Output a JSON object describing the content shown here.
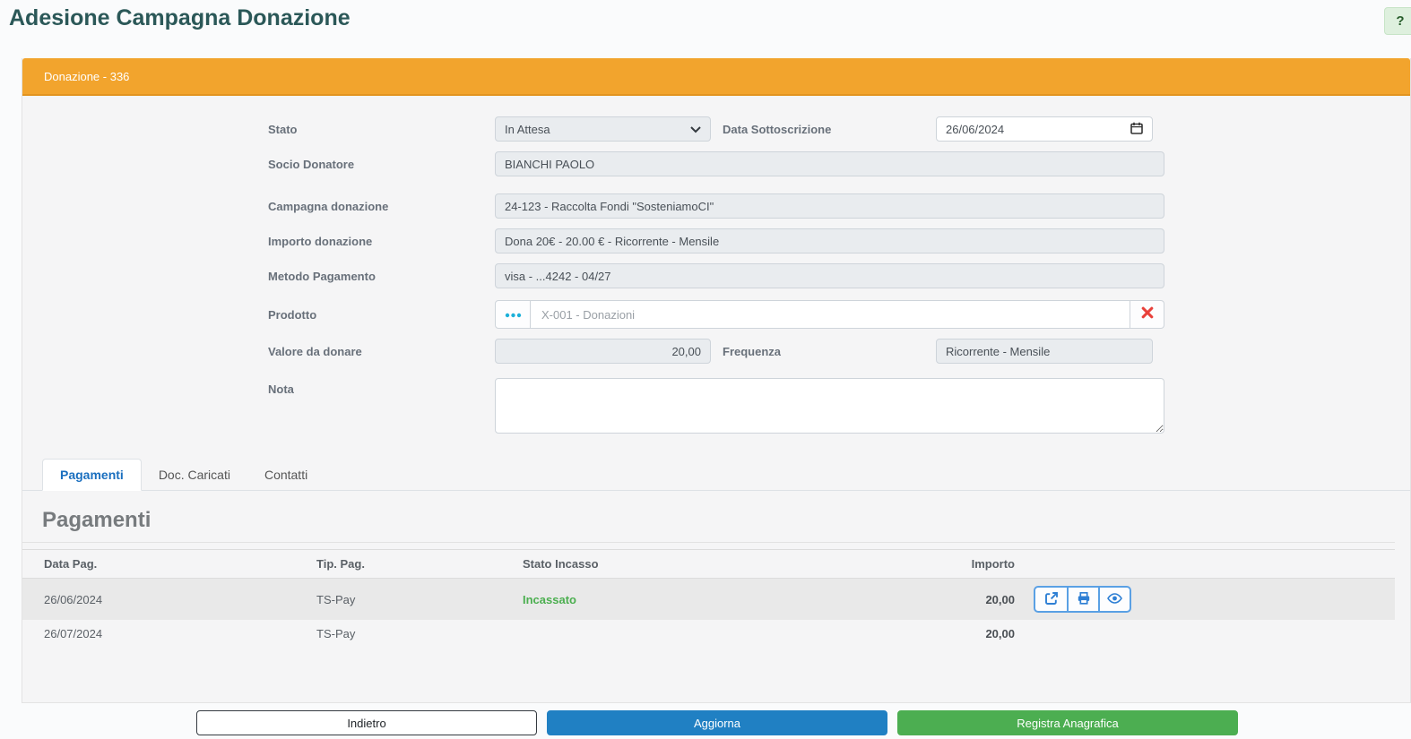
{
  "page": {
    "title": "Adesione Campagna Donazione",
    "help_label": "?"
  },
  "panel": {
    "header": "Donazione - 336"
  },
  "form": {
    "stato": {
      "label": "Stato",
      "value": "In Attesa"
    },
    "data_sottoscrizione": {
      "label": "Data Sottoscrizione",
      "value": "26/06/2024"
    },
    "socio_donatore": {
      "label": "Socio Donatore",
      "value": "BIANCHI PAOLO"
    },
    "campagna_donazione": {
      "label": "Campagna donazione",
      "value": "24-123 - Raccolta Fondi \"SosteniamoCI\""
    },
    "importo_donazione": {
      "label": "Importo donazione",
      "value": "Dona 20€ - 20.00 € - Ricorrente - Mensile"
    },
    "metodo_pagamento": {
      "label": "Metodo Pagamento",
      "value": "visa - ...4242 - 04/27"
    },
    "prodotto": {
      "label": "Prodotto",
      "value": "X-001 - Donazioni"
    },
    "valore_da_donare": {
      "label": "Valore da donare",
      "value": "20,00"
    },
    "frequenza": {
      "label": "Frequenza",
      "value": "Ricorrente - Mensile"
    },
    "nota": {
      "label": "Nota",
      "value": ""
    }
  },
  "tabs": [
    {
      "label": "Pagamenti",
      "active": true
    },
    {
      "label": "Doc. Caricati",
      "active": false
    },
    {
      "label": "Contatti",
      "active": false
    }
  ],
  "payments": {
    "section_title": "Pagamenti",
    "columns": {
      "data": "Data Pag.",
      "tipo": "Tip. Pag.",
      "stato": "Stato Incasso",
      "importo": "Importo"
    },
    "rows": [
      {
        "data_pag": "26/06/2024",
        "tip_pag": "TS-Pay",
        "stato_incasso": "Incassato",
        "importo": "20,00"
      },
      {
        "data_pag": "26/07/2024",
        "tip_pag": "TS-Pay",
        "stato_incasso": "",
        "importo": "20,00"
      }
    ]
  },
  "footer": {
    "back": "Indietro",
    "update": "Aggiorna",
    "register": "Registra Anagrafica"
  },
  "colors": {
    "panel_header": "#F2A42D",
    "title_text": "#2B5858",
    "active_tab_text": "#1A6FBF",
    "incassato_text": "#4CAF50",
    "primary_button": "#2080C3",
    "success_button": "#4CAE51",
    "clear_icon": "#E8403A",
    "lookup_dots_icon": "#1CB0D9",
    "action_icons": "#2E7FD4"
  }
}
